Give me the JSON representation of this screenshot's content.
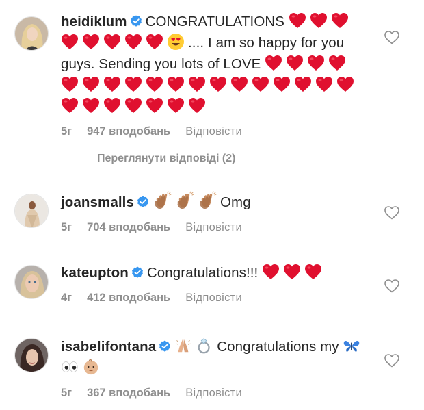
{
  "comments": [
    {
      "username": "heidiklum",
      "text_1": "CONGRATULATIONS",
      "text_2": ".... I am so happy for you guys. Sending you lots of LOVE",
      "time": "5г",
      "likes": "947 вподобань",
      "reply": "Відповісти"
    },
    {
      "username": "joansmalls",
      "text": "Omg",
      "time": "5г",
      "likes": "704 вподобань",
      "reply": "Відповісти"
    },
    {
      "username": "kateupton",
      "text": "Congratulations!!!",
      "time": "4г",
      "likes": "412 вподобань",
      "reply": "Відповісти"
    },
    {
      "username": "isabelifontana",
      "text": "Congratulations my",
      "time": "5г",
      "likes": "367 вподобань",
      "reply": "Відповісти"
    }
  ],
  "view_replies": "Переглянути відповіді (2)",
  "icons": {
    "verified": "verified-badge-icon",
    "heart_emoji": "red-heart-emoji",
    "like": "heart-outline-icon"
  },
  "colors": {
    "verified": "#3897f0",
    "heart": "#e0102f",
    "meta_text": "#8e8e8e"
  }
}
